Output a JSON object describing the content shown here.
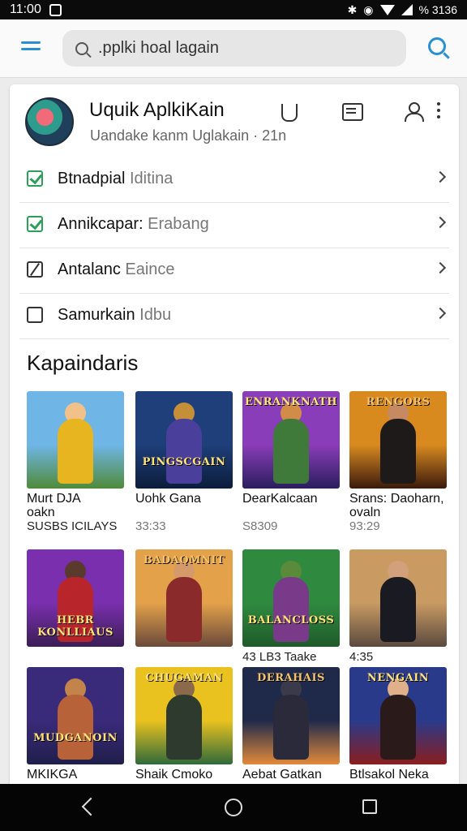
{
  "status_bar": {
    "time": "11:00",
    "battery": "% 3136"
  },
  "search": {
    "value": ".pplki hoal lagain"
  },
  "profile": {
    "title": "Uquik AplkiKain",
    "subtitle": "Uandake kanm Uglakain ·   21n"
  },
  "settings": [
    {
      "bold": "Btnadpial",
      "light": " Iditina",
      "state": "checked"
    },
    {
      "bold": "Annikcapar:",
      "light": " Erabang",
      "state": "checked"
    },
    {
      "bold": "Antalanc",
      "light": " Eaince",
      "state": "slashed"
    },
    {
      "bold": "Samurkain",
      "light": " Idbu",
      "state": "unchecked"
    }
  ],
  "section_title": "Kapaindaris",
  "games": [
    {
      "name": "Murt DJA\noakn",
      "meta": "SUSBS ICILAYS",
      "logo": "",
      "colors": {
        "sky": "#6fb6e6",
        "ground": "#4f8a3a",
        "figure": "#e7b51f",
        "head": "#f2c18a"
      }
    },
    {
      "name": "Uohk Gana",
      "meta": "33:33",
      "logo": "PINGSCGAIN",
      "colors": {
        "sky": "#1e3f7a",
        "ground": "#0c1d3c",
        "figure": "#4a3f9a",
        "head": "#c58f3a"
      }
    },
    {
      "name": "DearKalcaan",
      "meta": "S8309",
      "logo": "ENRANKNATH",
      "colors": {
        "sky": "#8a3db8",
        "ground": "#2a1e5e",
        "figure": "#3f7a3a",
        "head": "#d28c4a"
      }
    },
    {
      "name": "Srans: Daoharn,\novaln",
      "meta": "93:29",
      "logo": "RENGORS",
      "colors": {
        "sky": "#d98a1f",
        "ground": "#3a1a0c",
        "figure": "#1e1a1a",
        "head": "#c58a62"
      }
    },
    {
      "name": "",
      "meta": "",
      "logo": "HEBR KONLLIAUS",
      "colors": {
        "sky": "#7a2fae",
        "ground": "#3a1e55",
        "figure": "#b8262c",
        "head": "#5a3a2c"
      }
    },
    {
      "name": "",
      "meta": "",
      "logo": "BADAQMNIT",
      "colors": {
        "sky": "#e3a14a",
        "ground": "#6a4a3a",
        "figure": "#8a2a2a",
        "head": "#d49a6a"
      }
    },
    {
      "name": "",
      "meta": "43 LB3 Taake",
      "logo": "BALANCLOSS",
      "colors": {
        "sky": "#2f8a3f",
        "ground": "#1f5a2a",
        "figure": "#7a3a8a",
        "head": "#5a8a3a"
      }
    },
    {
      "name": "",
      "meta": "4:35",
      "logo": "",
      "colors": {
        "sky": "#c99a62",
        "ground": "#5a4a3f",
        "figure": "#1a1a22",
        "head": "#d2a07a"
      }
    },
    {
      "name": "MKIKGA",
      "meta": "",
      "logo": "MUDGANOIN",
      "colors": {
        "sky": "#3a2a7a",
        "ground": "#1f1f4a",
        "figure": "#b8623a",
        "head": "#c2844a"
      }
    },
    {
      "name": "Shaik Cmoko",
      "meta": "",
      "logo": "CHUGAMAN",
      "colors": {
        "sky": "#e9c21f",
        "ground": "#2f6a3a",
        "figure": "#2f3a2f",
        "head": "#8a6a4a"
      }
    },
    {
      "name": "Aebat Gatkan",
      "meta": "",
      "logo": "DERAHAIS",
      "colors": {
        "sky": "#1f2a4a",
        "ground": "#e38a3a",
        "figure": "#2a2a3a",
        "head": "#3a3a4a"
      }
    },
    {
      "name": "Btlsakol Neka",
      "meta": "",
      "logo": "NENGAIN",
      "colors": {
        "sky": "#2a3a8a",
        "ground": "#8a1e1e",
        "figure": "#2a1a1a",
        "head": "#e0b08a"
      }
    }
  ]
}
